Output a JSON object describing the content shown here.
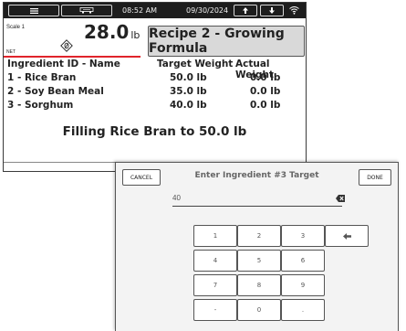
{
  "statusbar": {
    "menu_icon": "hamburger-menu-icon",
    "scale_icon": "scale-icon",
    "time": "08:52 AM",
    "date": "09/30/2024",
    "upload_icon": "arrow-up-icon",
    "download_icon": "arrow-down-icon",
    "wifi_icon": "wifi-icon"
  },
  "scale": {
    "label": "Scale 1",
    "weight": "28.0",
    "unit": "lb",
    "mode": "NET",
    "zero_icon": "zero-icon"
  },
  "recipe": {
    "title": "Recipe 2 - Growing Formula"
  },
  "table": {
    "headers": [
      "Ingredient ID - Name",
      "Target Weight",
      "Actual Weight"
    ],
    "rows": [
      {
        "name": "1 - Rice Bran",
        "target": "50.0 lb",
        "actual": "0.0 lb"
      },
      {
        "name": "2 - Soy Bean Meal",
        "target": "35.0 lb",
        "actual": "0.0 lb"
      },
      {
        "name": "3 - Sorghum",
        "target": "40.0 lb",
        "actual": "0.0 lb"
      }
    ]
  },
  "status_message": "Filling Rice Bran to 50.0 lb",
  "keypad": {
    "cancel_label": "CANCEL",
    "title": "Enter Ingredient #3 Target",
    "done_label": "DONE",
    "input_value": "40",
    "keys": [
      "1",
      "2",
      "3",
      "4",
      "5",
      "6",
      "7",
      "8",
      "9",
      "-",
      "0",
      "."
    ],
    "backspace_icon": "backspace-icon",
    "left_arrow_icon": "arrow-left-icon"
  },
  "colors": {
    "statusbar_bg": "#1d1d1d",
    "accent_red": "#e0242b",
    "recipe_box_bg": "#d9d9d9",
    "overlay_bg": "#f3f3f3"
  }
}
